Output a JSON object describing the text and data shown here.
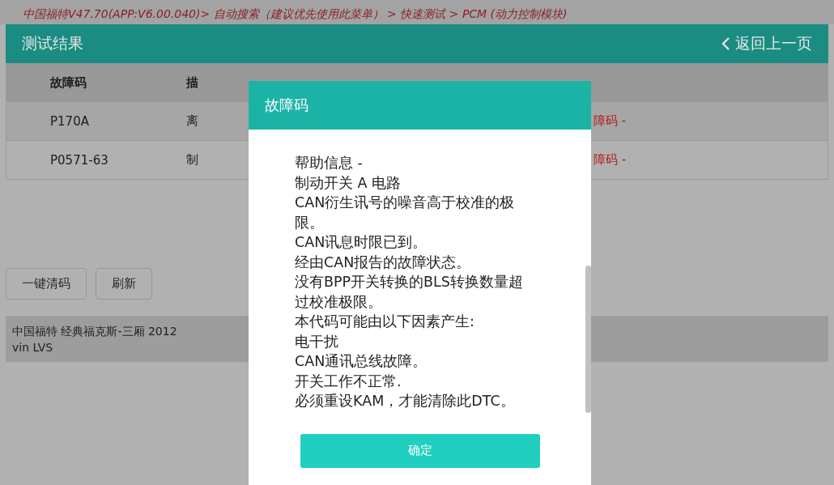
{
  "breadcrumb": "中国福特V47.70(APP:V6.00.040)> 自动搜索（建议优先使用此菜单） > 快速测试 > PCM (动力控制模块)",
  "header": {
    "title": "测试结果",
    "back": "返回上一页"
  },
  "table": {
    "columns": [
      "故障码",
      "描"
    ],
    "rows": [
      {
        "code": "P170A",
        "description": "离",
        "status": "障码 -"
      },
      {
        "code": "P0571-63",
        "description": "制",
        "status": "障码 -"
      }
    ]
  },
  "buttons": [
    "一键清码",
    "刷新"
  ],
  "vehicle": {
    "model": "中国福特 经典福克斯-三厢 2012",
    "vin": "vin LVS"
  },
  "dialog": {
    "title": "故障码",
    "lines": [
      "帮助信息 -",
      "制动开关 A 电路",
      "CAN衍生讯号的噪音高于校准的极限。",
      "CAN讯息时限已到。",
      "经由CAN报告的故障状态。",
      "没有BPP开关转换的BLS转换数量超过校准极限。",
      "本代码可能由以下因素产生:",
      "电干扰",
      "CAN通讯总线故障。",
      "开关工作不正常.",
      "必须重设KAM，才能清除此DTC。"
    ],
    "confirm": "确定"
  }
}
